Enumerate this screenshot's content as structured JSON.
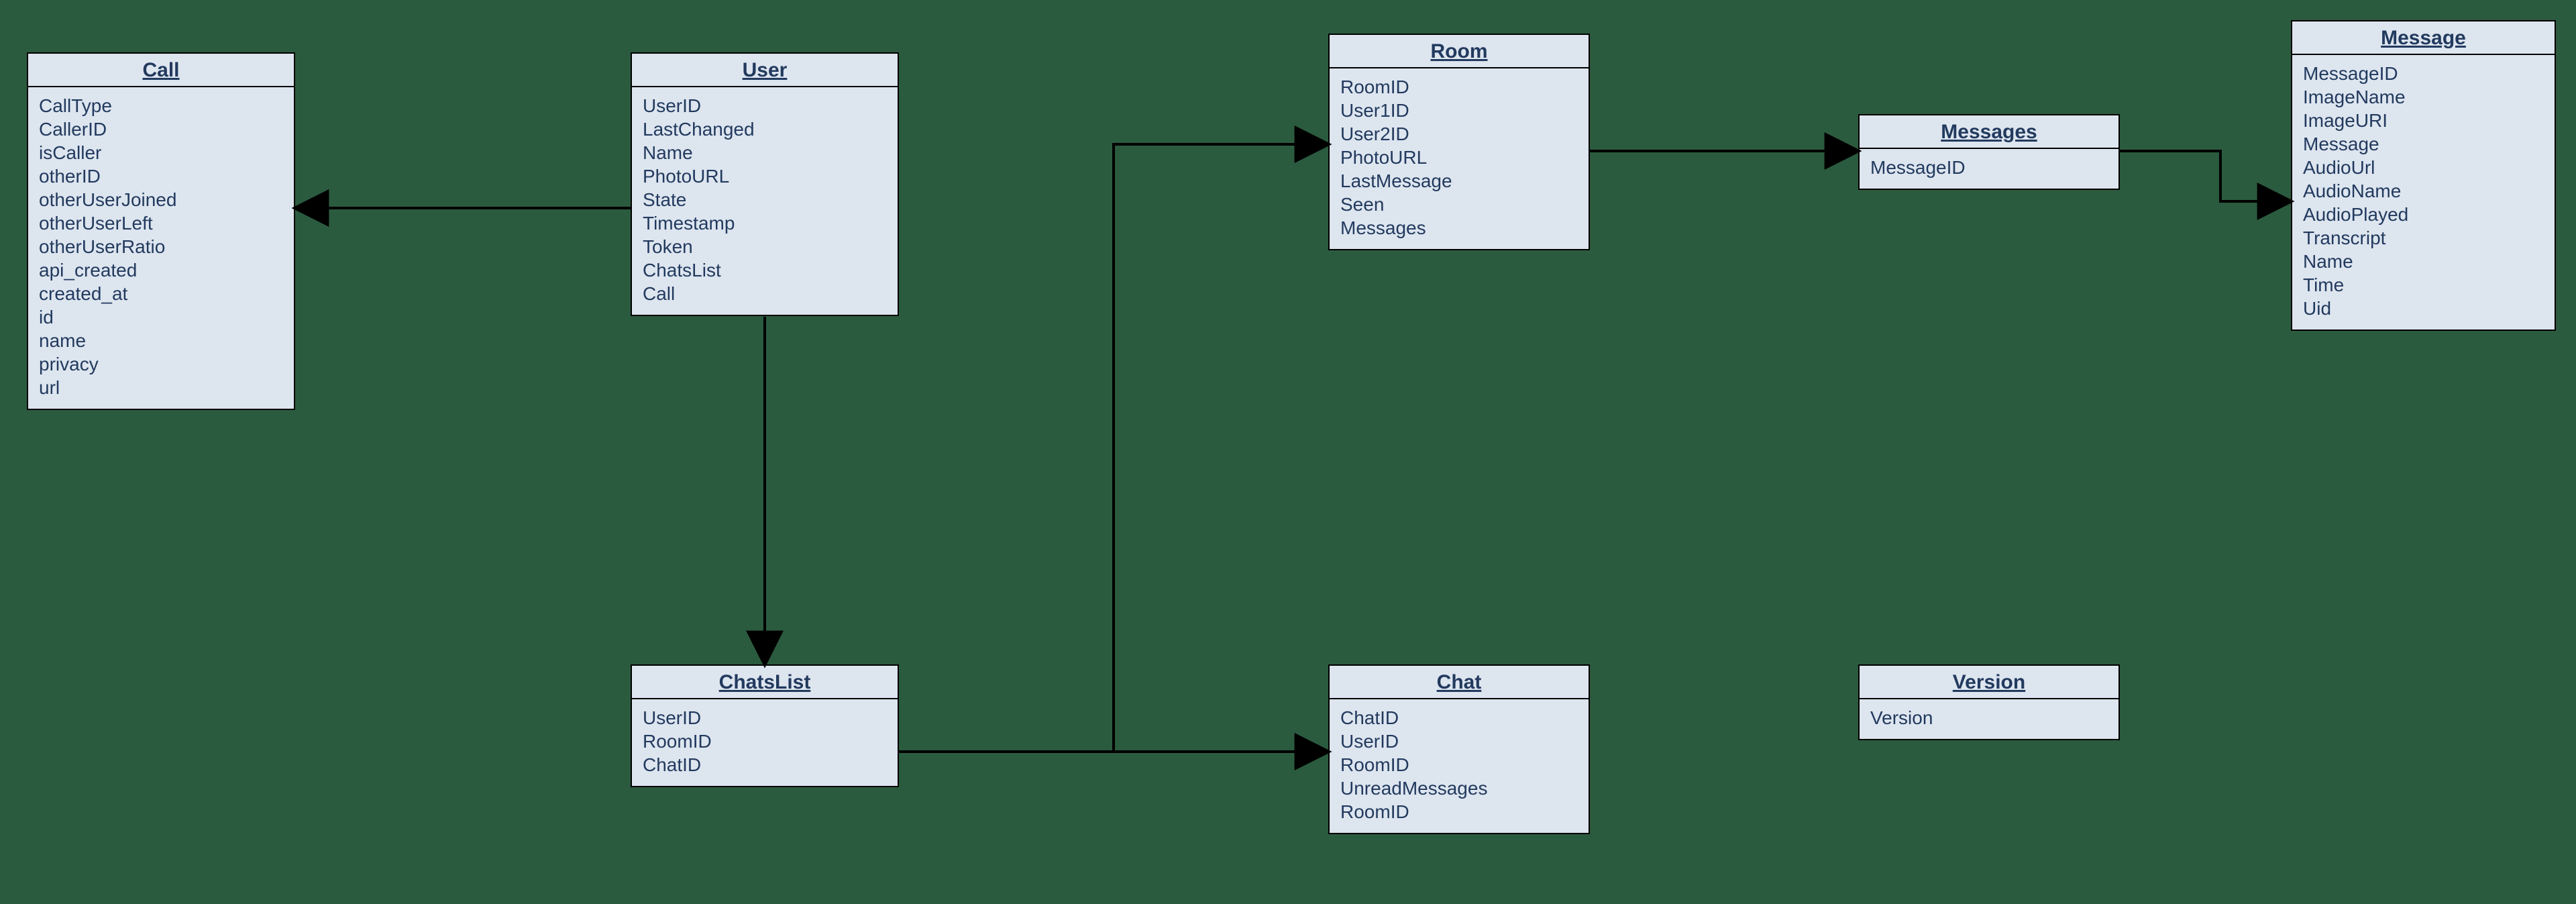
{
  "diagram_type": "entity-relationship",
  "colors": {
    "background": "#2b5b3f",
    "entity_fill": "#dde5ef",
    "entity_border": "#000000",
    "text": "#223a5e"
  },
  "entities": {
    "call": {
      "title": "Call",
      "fields": [
        "CallType",
        "CallerID",
        "isCaller",
        "otherID",
        "otherUserJoined",
        "otherUserLeft",
        "otherUserRatio",
        "api_created",
        "created_at",
        "id",
        "name",
        "privacy",
        "url"
      ]
    },
    "user": {
      "title": "User",
      "fields": [
        "UserID",
        "LastChanged",
        "Name",
        "PhotoURL",
        "State",
        "Timestamp",
        "Token",
        "ChatsList",
        "Call"
      ]
    },
    "room": {
      "title": "Room",
      "fields": [
        "RoomID",
        "User1ID",
        "User2ID",
        "PhotoURL",
        "LastMessage",
        "Seen",
        "Messages"
      ]
    },
    "messages": {
      "title": "Messages",
      "fields": [
        "MessageID"
      ]
    },
    "message": {
      "title": "Message",
      "fields": [
        "MessageID",
        "ImageName",
        "ImageURI",
        "Message",
        "AudioUrl",
        "AudioName",
        "AudioPlayed",
        "Transcript",
        "Name",
        "Time",
        "Uid"
      ]
    },
    "chatslist": {
      "title": "ChatsList",
      "fields": [
        "UserID",
        "RoomID",
        "ChatID"
      ]
    },
    "chat": {
      "title": "Chat",
      "fields": [
        "ChatID",
        "UserID",
        "RoomID",
        "UnreadMessages",
        "RoomID"
      ]
    },
    "version": {
      "title": "Version",
      "fields": [
        "Version"
      ]
    }
  },
  "relationships": [
    {
      "from": "user",
      "to": "call"
    },
    {
      "from": "user",
      "to": "chatslist"
    },
    {
      "from": "chatslist",
      "to": "chat"
    },
    {
      "from": "chat",
      "to": "room"
    },
    {
      "from": "room",
      "to": "messages"
    },
    {
      "from": "messages",
      "to": "message"
    }
  ]
}
